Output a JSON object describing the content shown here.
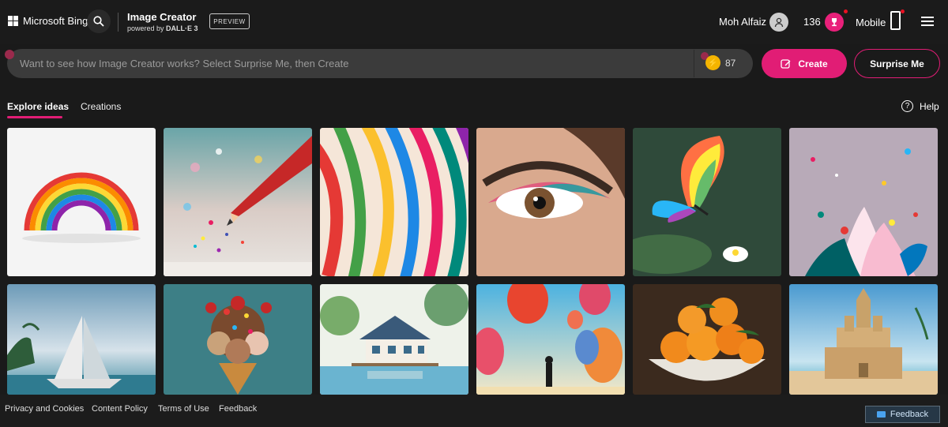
{
  "header": {
    "brand": "Microsoft Bing",
    "product_title": "Image Creator",
    "powered_prefix": "powered by",
    "powered_model": "DALL·E 3",
    "preview_badge": "PREVIEW",
    "user_name": "Moh Alfaiz",
    "rewards_points": "136",
    "mobile_label": "Mobile",
    "icons": [
      "windows-logo-icon",
      "search-icon",
      "user-avatar-icon",
      "trophy-icon",
      "phone-icon",
      "hamburger-menu-icon"
    ]
  },
  "prompt": {
    "placeholder": "Want to see how Image Creator works? Select Surprise Me, then Create",
    "value": "",
    "boosts": "87",
    "create_label": "Create",
    "surprise_label": "Surprise Me"
  },
  "tabs": [
    {
      "label": "Explore ideas",
      "active": true
    },
    {
      "label": "Creations",
      "active": false
    }
  ],
  "help_label": "Help",
  "gallery": [
    {
      "subject": "paper-rainbow"
    },
    {
      "subject": "pencil-glitter"
    },
    {
      "subject": "colorful-ribbons"
    },
    {
      "subject": "eye-makeup"
    },
    {
      "subject": "rainbow-butterfly"
    },
    {
      "subject": "paint-splash"
    },
    {
      "subject": "paper-sailboat"
    },
    {
      "subject": "ice-cream-cone"
    },
    {
      "subject": "lake-house"
    },
    {
      "subject": "hot-air-balloons"
    },
    {
      "subject": "orange-bowl"
    },
    {
      "subject": "sand-castle"
    }
  ],
  "footer": {
    "links": [
      "Privacy and Cookies",
      "Content Policy",
      "Terms of Use",
      "Feedback"
    ],
    "feedback_button": "Feedback"
  },
  "colors": {
    "accent": "#e11d75",
    "background": "#1a1a1a",
    "prompt_bg": "#3b3b3b"
  }
}
